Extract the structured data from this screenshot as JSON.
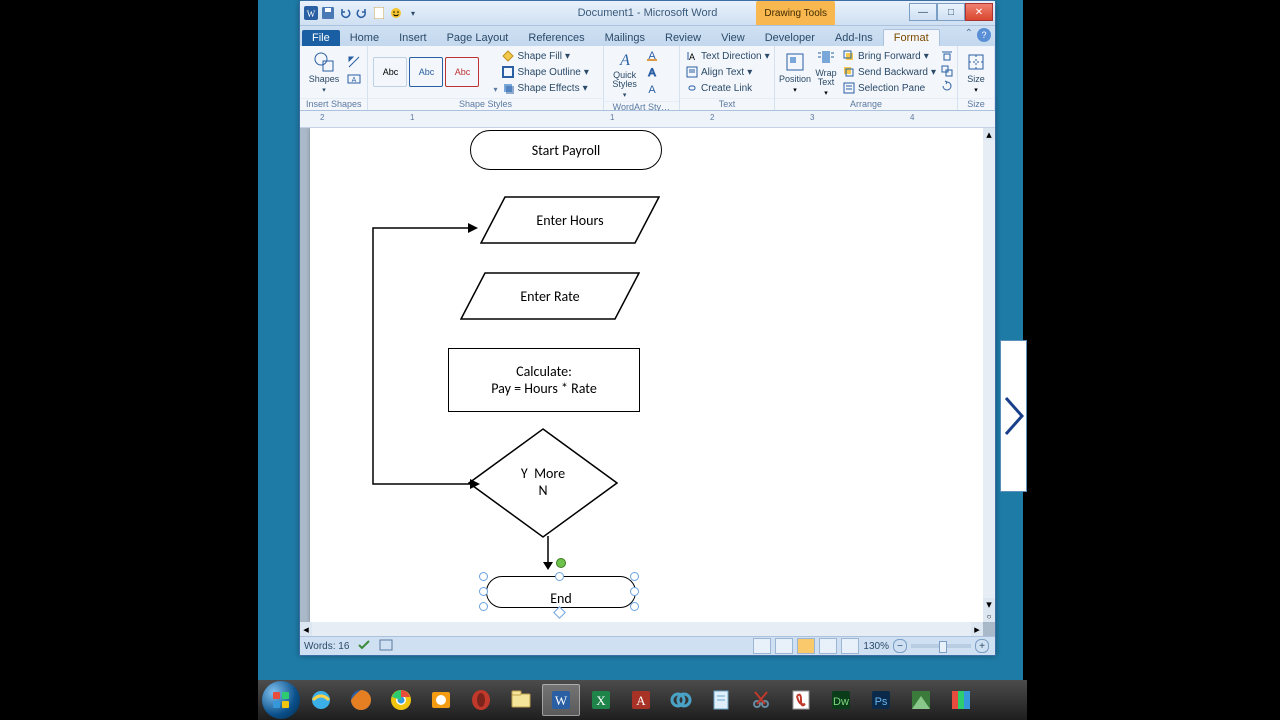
{
  "window": {
    "title": "Document1 - Microsoft Word",
    "contextual_tab": "Drawing Tools"
  },
  "tabs": {
    "file": "File",
    "items": [
      "Home",
      "Insert",
      "Page Layout",
      "References",
      "Mailings",
      "Review",
      "View",
      "Developer",
      "Add-Ins"
    ],
    "active": "Format"
  },
  "ribbon": {
    "insert_shapes": {
      "label": "Insert Shapes",
      "shapes_btn": "Shapes"
    },
    "shape_styles": {
      "label": "Shape Styles",
      "swatch_text": "Abc",
      "fill": "Shape Fill",
      "outline": "Shape Outline",
      "effects": "Shape Effects"
    },
    "wordart": {
      "label": "WordArt Sty…",
      "quick": "Quick Styles"
    },
    "text": {
      "label": "Text",
      "dir": "Text Direction",
      "align": "Align Text",
      "link": "Create Link"
    },
    "arrange": {
      "label": "Arrange",
      "position": "Position",
      "wrap": "Wrap Text",
      "fwd": "Bring Forward",
      "back": "Send Backward",
      "pane": "Selection Pane"
    },
    "size": {
      "label": "Size",
      "btn": "Size"
    }
  },
  "ruler": {
    "marks": [
      "2",
      "1",
      "",
      "1",
      "2",
      "3",
      "4"
    ]
  },
  "flowchart": {
    "start": "Start Payroll",
    "hours": "Enter Hours",
    "rate": "Enter Rate",
    "calc1": "Calculate:",
    "calc2": "Pay = Hours * Rate",
    "dec_y": "Y",
    "dec_more": "More",
    "dec_n": "N",
    "end": "End"
  },
  "status": {
    "words_lbl": "Words:",
    "words": "16",
    "zoom": "130%"
  },
  "taskbar": {
    "items": [
      {
        "name": "start-orb"
      },
      {
        "name": "ie-icon"
      },
      {
        "name": "firefox-icon"
      },
      {
        "name": "chrome-icon"
      },
      {
        "name": "outlook-icon"
      },
      {
        "name": "opera-icon"
      },
      {
        "name": "explorer-icon"
      },
      {
        "name": "word-icon"
      },
      {
        "name": "excel-icon"
      },
      {
        "name": "access-icon"
      },
      {
        "name": "app-icon-1"
      },
      {
        "name": "notepad-icon"
      },
      {
        "name": "snip-icon"
      },
      {
        "name": "acrobat-icon"
      },
      {
        "name": "dreamweaver-icon"
      },
      {
        "name": "photoshop-icon"
      },
      {
        "name": "app-icon-2"
      },
      {
        "name": "app-icon-3"
      }
    ]
  }
}
